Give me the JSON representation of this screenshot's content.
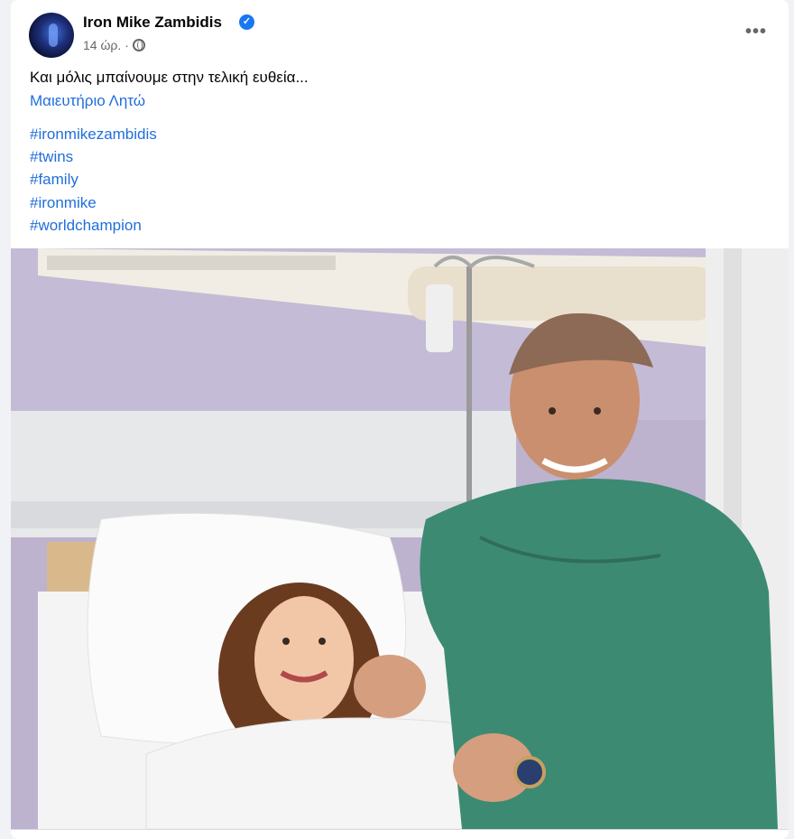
{
  "post": {
    "author": "Iron Mike Zambidis",
    "time": "14 ώρ.",
    "separator": "·",
    "more_label": "•••",
    "caption": "Και μόλις μπαίνουμε στην τελική ευθεία...",
    "location": "Μαιευτήριο Λητώ",
    "hashtags": [
      "#ironmikezambidis",
      "#twins",
      "#family",
      "#ironmike",
      "#worldchampion"
    ]
  },
  "icons": {
    "verified": "verified-badge-icon",
    "audience": "globe-icon",
    "more": "more-options-icon"
  },
  "colors": {
    "link": "#216fdb",
    "verified": "#1877f2",
    "text": "#050505",
    "meta": "#65676b",
    "background": "#f0f2f5"
  }
}
